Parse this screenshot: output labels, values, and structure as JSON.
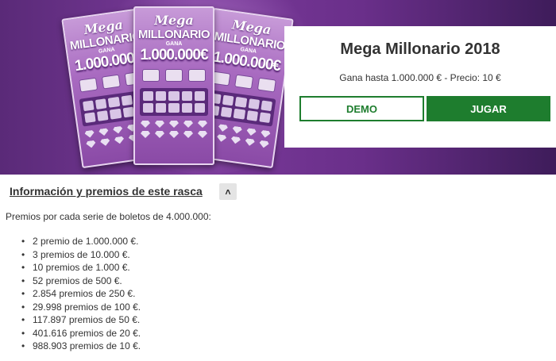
{
  "game": {
    "title": "Mega Millonario 2018",
    "subtitle": "Gana hasta 1.000.000 € - Precio: 10 €",
    "demo_label": "DEMO",
    "play_label": "JUGAR"
  },
  "ticket": {
    "brand": "Mega",
    "name": "MILLONARIO",
    "gana": "GANA",
    "amount": "1.000.000€"
  },
  "info": {
    "heading": "Información y premios de este rasca",
    "toggle_glyph": "˄",
    "intro": "Premios por cada serie de boletos de 4.000.000:",
    "prizes": [
      "2 premio de 1.000.000 €.",
      "3 premios de 10.000 €.",
      "10 premios de 1.000 €.",
      "52 premios de 500 €.",
      "2.854 premios de 250 €.",
      "29.998 premios de 100 €.",
      "117.897 premios de 50 €.",
      "401.616 premios de 20 €.",
      "988.903 premios de 10 €."
    ]
  },
  "colors": {
    "accent_green": "#1e7d2e",
    "hero_purple": "#6a2f8a"
  }
}
